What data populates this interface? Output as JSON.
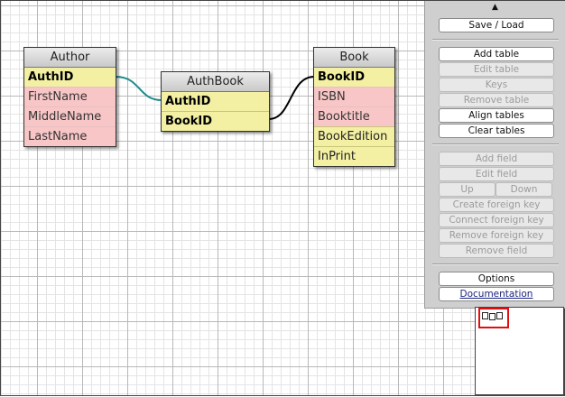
{
  "tables": [
    {
      "name": "Author",
      "rows": [
        {
          "label": "AuthID",
          "kind": "pk"
        },
        {
          "label": "FirstName",
          "kind": "reg"
        },
        {
          "label": "MiddleName",
          "kind": "reg"
        },
        {
          "label": "LastName",
          "kind": "reg"
        }
      ]
    },
    {
      "name": "AuthBook",
      "rows": [
        {
          "label": "AuthID",
          "kind": "pk"
        },
        {
          "label": "BookID",
          "kind": "pk"
        }
      ]
    },
    {
      "name": "Book",
      "rows": [
        {
          "label": "BookID",
          "kind": "pk"
        },
        {
          "label": "ISBN",
          "kind": "reg"
        },
        {
          "label": "Booktitle",
          "kind": "reg"
        },
        {
          "label": "BookEdition",
          "kind": "fk"
        },
        {
          "label": "InPrint",
          "kind": "fk"
        }
      ]
    }
  ],
  "relations": [
    {
      "from": "Author.AuthID",
      "to": "AuthBook.AuthID",
      "color": "#1a8c8c"
    },
    {
      "from": "AuthBook.BookID",
      "to": "Book.BookID",
      "color": "#000000"
    }
  ],
  "panel": {
    "collapse_icon": "triangle-up-icon",
    "save_load": "Save / Load",
    "add_table": "Add table",
    "edit_table": "Edit table",
    "keys": "Keys",
    "remove_table": "Remove table",
    "align_tables": "Align tables",
    "clear_tables": "Clear tables",
    "add_field": "Add field",
    "edit_field": "Edit field",
    "up": "Up",
    "down": "Down",
    "create_fk": "Create foreign key",
    "connect_fk": "Connect foreign key",
    "remove_fk": "Remove foreign key",
    "remove_field": "Remove field",
    "options": "Options",
    "documentation": "Documentation"
  },
  "colors": {
    "pk_row": "#f3f0a3",
    "regular_row": "#f8c6c6",
    "panel_bg": "#cfcfcf",
    "minimap_viewport": "#e01010"
  }
}
